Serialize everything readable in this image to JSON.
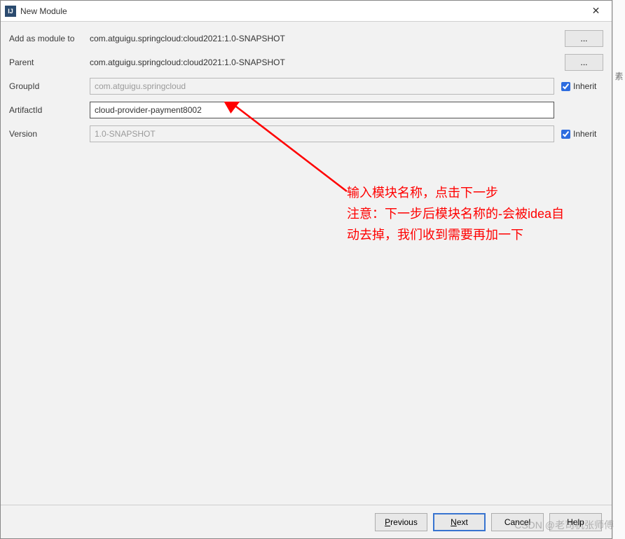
{
  "window": {
    "title": "New Module",
    "icon_label": "IJ"
  },
  "form": {
    "add_as_module_label": "Add as module to",
    "add_as_module_value": "com.atguigu.springcloud:cloud2021:1.0-SNAPSHOT",
    "parent_label": "Parent",
    "parent_value": "com.atguigu.springcloud:cloud2021:1.0-SNAPSHOT",
    "groupid_label": "GroupId",
    "groupid_value": "com.atguigu.springcloud",
    "groupid_inherit_label": "Inherit",
    "artifactid_label": "ArtifactId",
    "artifactid_value": "cloud-provider-payment8002",
    "version_label": "Version",
    "version_value": "1.0-SNAPSHOT",
    "version_inherit_label": "Inherit",
    "ellipsis": "..."
  },
  "annotation": {
    "line1": "输入模块名称，点击下一步",
    "line2": "注意：下一步后模块名称的-会被idea自",
    "line3": "动去掉，我们收到需要再加一下"
  },
  "footer": {
    "previous": "Previous",
    "next": "Next",
    "cancel": "Cancel",
    "help": "Help"
  },
  "watermark": "CSDN @老司机张师傅",
  "sidebar_char": "素"
}
